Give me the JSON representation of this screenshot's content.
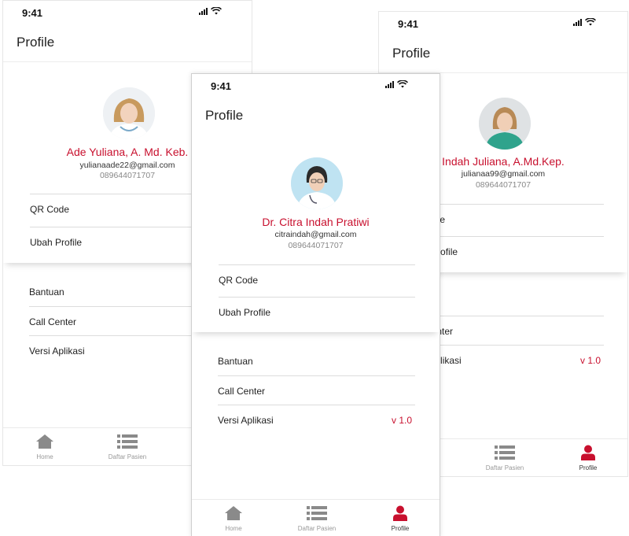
{
  "status": {
    "time": "9:41"
  },
  "header": {
    "title": "Profile"
  },
  "menu": {
    "qr_code": "QR Code",
    "edit_profile": "Ubah Profile",
    "help": "Bantuan",
    "call_center": "Call Center",
    "app_version": "Versi Aplikasi",
    "version_value": "v 1.0"
  },
  "tabs": {
    "home": "Home",
    "patients": "Daftar Pasien",
    "profile": "Profile"
  },
  "screens": {
    "left": {
      "name": "Ade Yuliana, A. Md. Keb.",
      "email": "yulianaade22@gmail.com",
      "phone": "089644071707"
    },
    "center": {
      "name": "Dr. Citra Indah Pratiwi",
      "email": "citraindah@gmail.com",
      "phone": "089644071707"
    },
    "right": {
      "name": "Indah Juliana, A.Md.Kep.",
      "email": "julianaa99@gmail.com",
      "phone": "089644071707"
    }
  },
  "colors": {
    "accent": "#c8102e",
    "inactive_icon": "#8a8a8a"
  }
}
